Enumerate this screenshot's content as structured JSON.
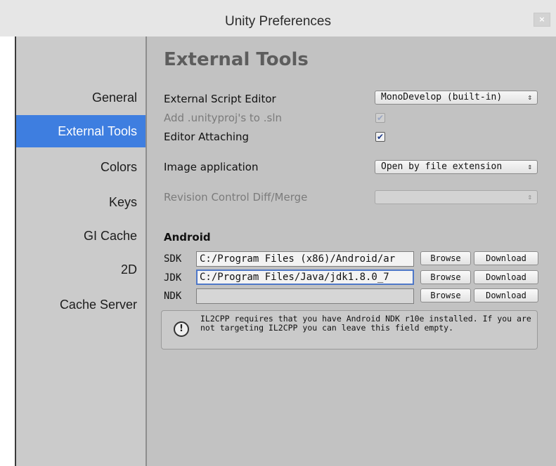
{
  "window": {
    "title": "Unity Preferences",
    "close_glyph": "×"
  },
  "sidebar": {
    "items": [
      {
        "label": "General"
      },
      {
        "label": "External Tools",
        "active": true
      },
      {
        "label": "Colors"
      },
      {
        "label": "Keys"
      },
      {
        "label": "GI Cache"
      },
      {
        "label": "2D"
      },
      {
        "label": "Cache Server"
      }
    ]
  },
  "main": {
    "heading": "External Tools",
    "script_editor": {
      "label": "External Script Editor",
      "value": "MonoDevelop (built-in)"
    },
    "add_unityproj": {
      "label": "Add .unityproj's to .sln",
      "checked": true,
      "enabled": false
    },
    "editor_attaching": {
      "label": "Editor Attaching",
      "checked": true
    },
    "image_app": {
      "label": "Image application",
      "value": "Open by file extension"
    },
    "revision": {
      "label": "Revision Control Diff/Merge",
      "value": "",
      "enabled": false
    },
    "android": {
      "title": "Android",
      "sdk": {
        "label": "SDK",
        "value": "C:/Program Files (x86)/Android/ar"
      },
      "jdk": {
        "label": "JDK",
        "value": "C:/Program Files/Java/jdk1.8.0_7"
      },
      "ndk": {
        "label": "NDK",
        "value": ""
      },
      "browse_label": "Browse",
      "download_label": "Download",
      "info": {
        "icon": "exclamation-icon",
        "text": "IL2CPP requires that you have Android NDK r10e installed. If you are not targeting IL2CPP you can leave this field empty."
      }
    }
  },
  "icons": {
    "dropdown_arrows": "⇕",
    "check": "✔"
  },
  "colors": {
    "selection": "#3e7ee0",
    "sidebar_bg": "#cbcbcb",
    "panel_bg": "#c2c2c2"
  }
}
